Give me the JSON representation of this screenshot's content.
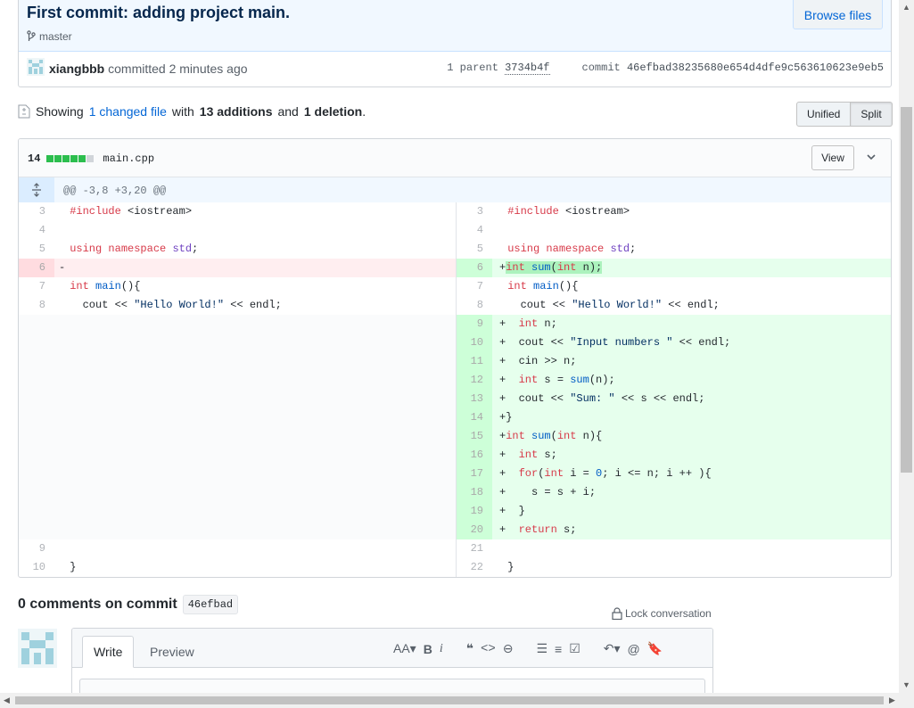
{
  "commit": {
    "title": "First commit: adding project main.",
    "branch": "master",
    "browse_files": "Browse files",
    "author": "xiangbbb",
    "action": "committed",
    "time": "2 minutes ago",
    "parent_label": "1 parent",
    "parent_sha": "3734b4f",
    "commit_label": "commit",
    "commit_sha": "46efbad38235680e654d4dfe9c563610623e9eb5"
  },
  "toc": {
    "showing": "Showing",
    "changed": "1 changed file",
    "with": "with",
    "additions": "13 additions",
    "and": "and",
    "deletions": "1 deletion",
    "period": "."
  },
  "view_toggle": {
    "unified": "Unified",
    "split": "Split",
    "selected": "Split"
  },
  "file": {
    "changes": "14",
    "name": "main.cpp",
    "view": "View",
    "hunk": "@@ -3,8 +3,20 @@",
    "diffstat_blocks": [
      "add",
      "add",
      "add",
      "add",
      "add",
      "neutral"
    ]
  },
  "diff": {
    "left": [
      {
        "num": "3",
        "type": "ctx",
        "code": " #include <iostream>"
      },
      {
        "num": "4",
        "type": "ctx",
        "code": ""
      },
      {
        "num": "5",
        "type": "ctx",
        "code": " using namespace std;"
      },
      {
        "num": "6",
        "type": "del",
        "code": "-"
      },
      {
        "num": "7",
        "type": "ctx",
        "code": " int main(){"
      },
      {
        "num": "8",
        "type": "ctx",
        "code": "   cout << \"Hello World!\" << endl;"
      },
      {
        "num": "",
        "type": "empty",
        "code": ""
      },
      {
        "num": "",
        "type": "empty",
        "code": ""
      },
      {
        "num": "",
        "type": "empty",
        "code": ""
      },
      {
        "num": "",
        "type": "empty",
        "code": ""
      },
      {
        "num": "",
        "type": "empty",
        "code": ""
      },
      {
        "num": "",
        "type": "empty",
        "code": ""
      },
      {
        "num": "",
        "type": "empty",
        "code": ""
      },
      {
        "num": "",
        "type": "empty",
        "code": ""
      },
      {
        "num": "",
        "type": "empty",
        "code": ""
      },
      {
        "num": "",
        "type": "empty",
        "code": ""
      },
      {
        "num": "",
        "type": "empty",
        "code": ""
      },
      {
        "num": "",
        "type": "empty",
        "code": ""
      },
      {
        "num": "9",
        "type": "ctx",
        "code": ""
      },
      {
        "num": "10",
        "type": "ctx",
        "code": " }"
      }
    ],
    "right": [
      {
        "num": "3",
        "type": "ctx",
        "code": " #include <iostream>"
      },
      {
        "num": "4",
        "type": "ctx",
        "code": ""
      },
      {
        "num": "5",
        "type": "ctx",
        "code": " using namespace std;"
      },
      {
        "num": "6",
        "type": "add",
        "code": "+int sum(int n);"
      },
      {
        "num": "7",
        "type": "ctx",
        "code": " int main(){"
      },
      {
        "num": "8",
        "type": "ctx",
        "code": "   cout << \"Hello World!\" << endl;"
      },
      {
        "num": "9",
        "type": "add",
        "code": "+  int n;"
      },
      {
        "num": "10",
        "type": "add",
        "code": "+  cout << \"Input numbers \" << endl;"
      },
      {
        "num": "11",
        "type": "add",
        "code": "+  cin >> n;"
      },
      {
        "num": "12",
        "type": "add",
        "code": "+  int s = sum(n);"
      },
      {
        "num": "13",
        "type": "add",
        "code": "+  cout << \"Sum: \" << s << endl;"
      },
      {
        "num": "14",
        "type": "add",
        "code": "+}"
      },
      {
        "num": "15",
        "type": "add",
        "code": "+int sum(int n){"
      },
      {
        "num": "16",
        "type": "add",
        "code": "+  int s;"
      },
      {
        "num": "17",
        "type": "add",
        "code": "+  for(int i = 0; i <= n; i ++ ){"
      },
      {
        "num": "18",
        "type": "add",
        "code": "+    s = s + i;"
      },
      {
        "num": "19",
        "type": "add",
        "code": "+  }"
      },
      {
        "num": "20",
        "type": "add",
        "code": "+  return s;"
      },
      {
        "num": "21",
        "type": "ctx",
        "code": ""
      },
      {
        "num": "22",
        "type": "ctx",
        "code": " }"
      }
    ]
  },
  "comments": {
    "title": "0 comments on commit",
    "sha": "46efbad",
    "lock": "Lock conversation",
    "tab_write": "Write",
    "tab_preview": "Preview"
  },
  "toolbar_icons": [
    "text-size-icon",
    "bold-icon",
    "italic-icon",
    "quote-icon",
    "code-icon",
    "link-icon",
    "unordered-list-icon",
    "ordered-list-icon",
    "task-list-icon",
    "reply-icon",
    "mention-icon",
    "bookmark-icon"
  ],
  "colors": {
    "link": "#0366d6",
    "addition_bg": "#e6ffed",
    "deletion_bg": "#ffeef0",
    "diffstat_add": "#2cbe4e"
  }
}
